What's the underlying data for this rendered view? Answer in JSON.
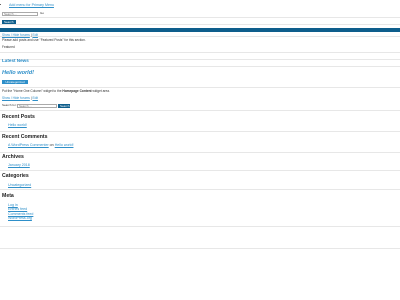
{
  "top": {
    "add_menu_link": "Add menu for Primary Menu",
    "search_placeholder": "Search ...",
    "search_button": "Go",
    "submit_button": "Search"
  },
  "featured": {
    "meta": "Show / Hinde Forums",
    "meta_link": "Show / Hide forums",
    "meta_link2": "Edit",
    "text": "Please add posts and use \"Featured Posts\" for this section.",
    "label": "Featured"
  },
  "latest": {
    "heading": "Latest News",
    "post_title": "Hello world!",
    "badge": "Uncategorized",
    "meta_link": "Show / Hide forums",
    "meta_link2": "Edit",
    "widget_note_prefix": "Put the \"Home One Column\" widget to the ",
    "widget_note_bold": "Homepage Content",
    "widget_note_suffix": " widget area.",
    "search_label": "Search for:",
    "search_placeholder": "Search ...",
    "search_button": "Search"
  },
  "recent_posts": {
    "heading": "Recent Posts",
    "items": [
      "Hello world!"
    ]
  },
  "recent_comments": {
    "heading": "Recent Comments",
    "author": "A WordPress Commenter",
    "on": " on ",
    "post": "Hello world!"
  },
  "archives": {
    "heading": "Archives",
    "items": [
      "January 2018"
    ]
  },
  "categories": {
    "heading": "Categories",
    "items": [
      "Uncategorized"
    ]
  },
  "meta": {
    "heading": "Meta",
    "items": [
      "Log in",
      "Entries feed",
      "Comments feed",
      "WordPress.org"
    ]
  },
  "colors": {
    "accent": "#2e8fc9",
    "bar": "#0e5e8c"
  }
}
